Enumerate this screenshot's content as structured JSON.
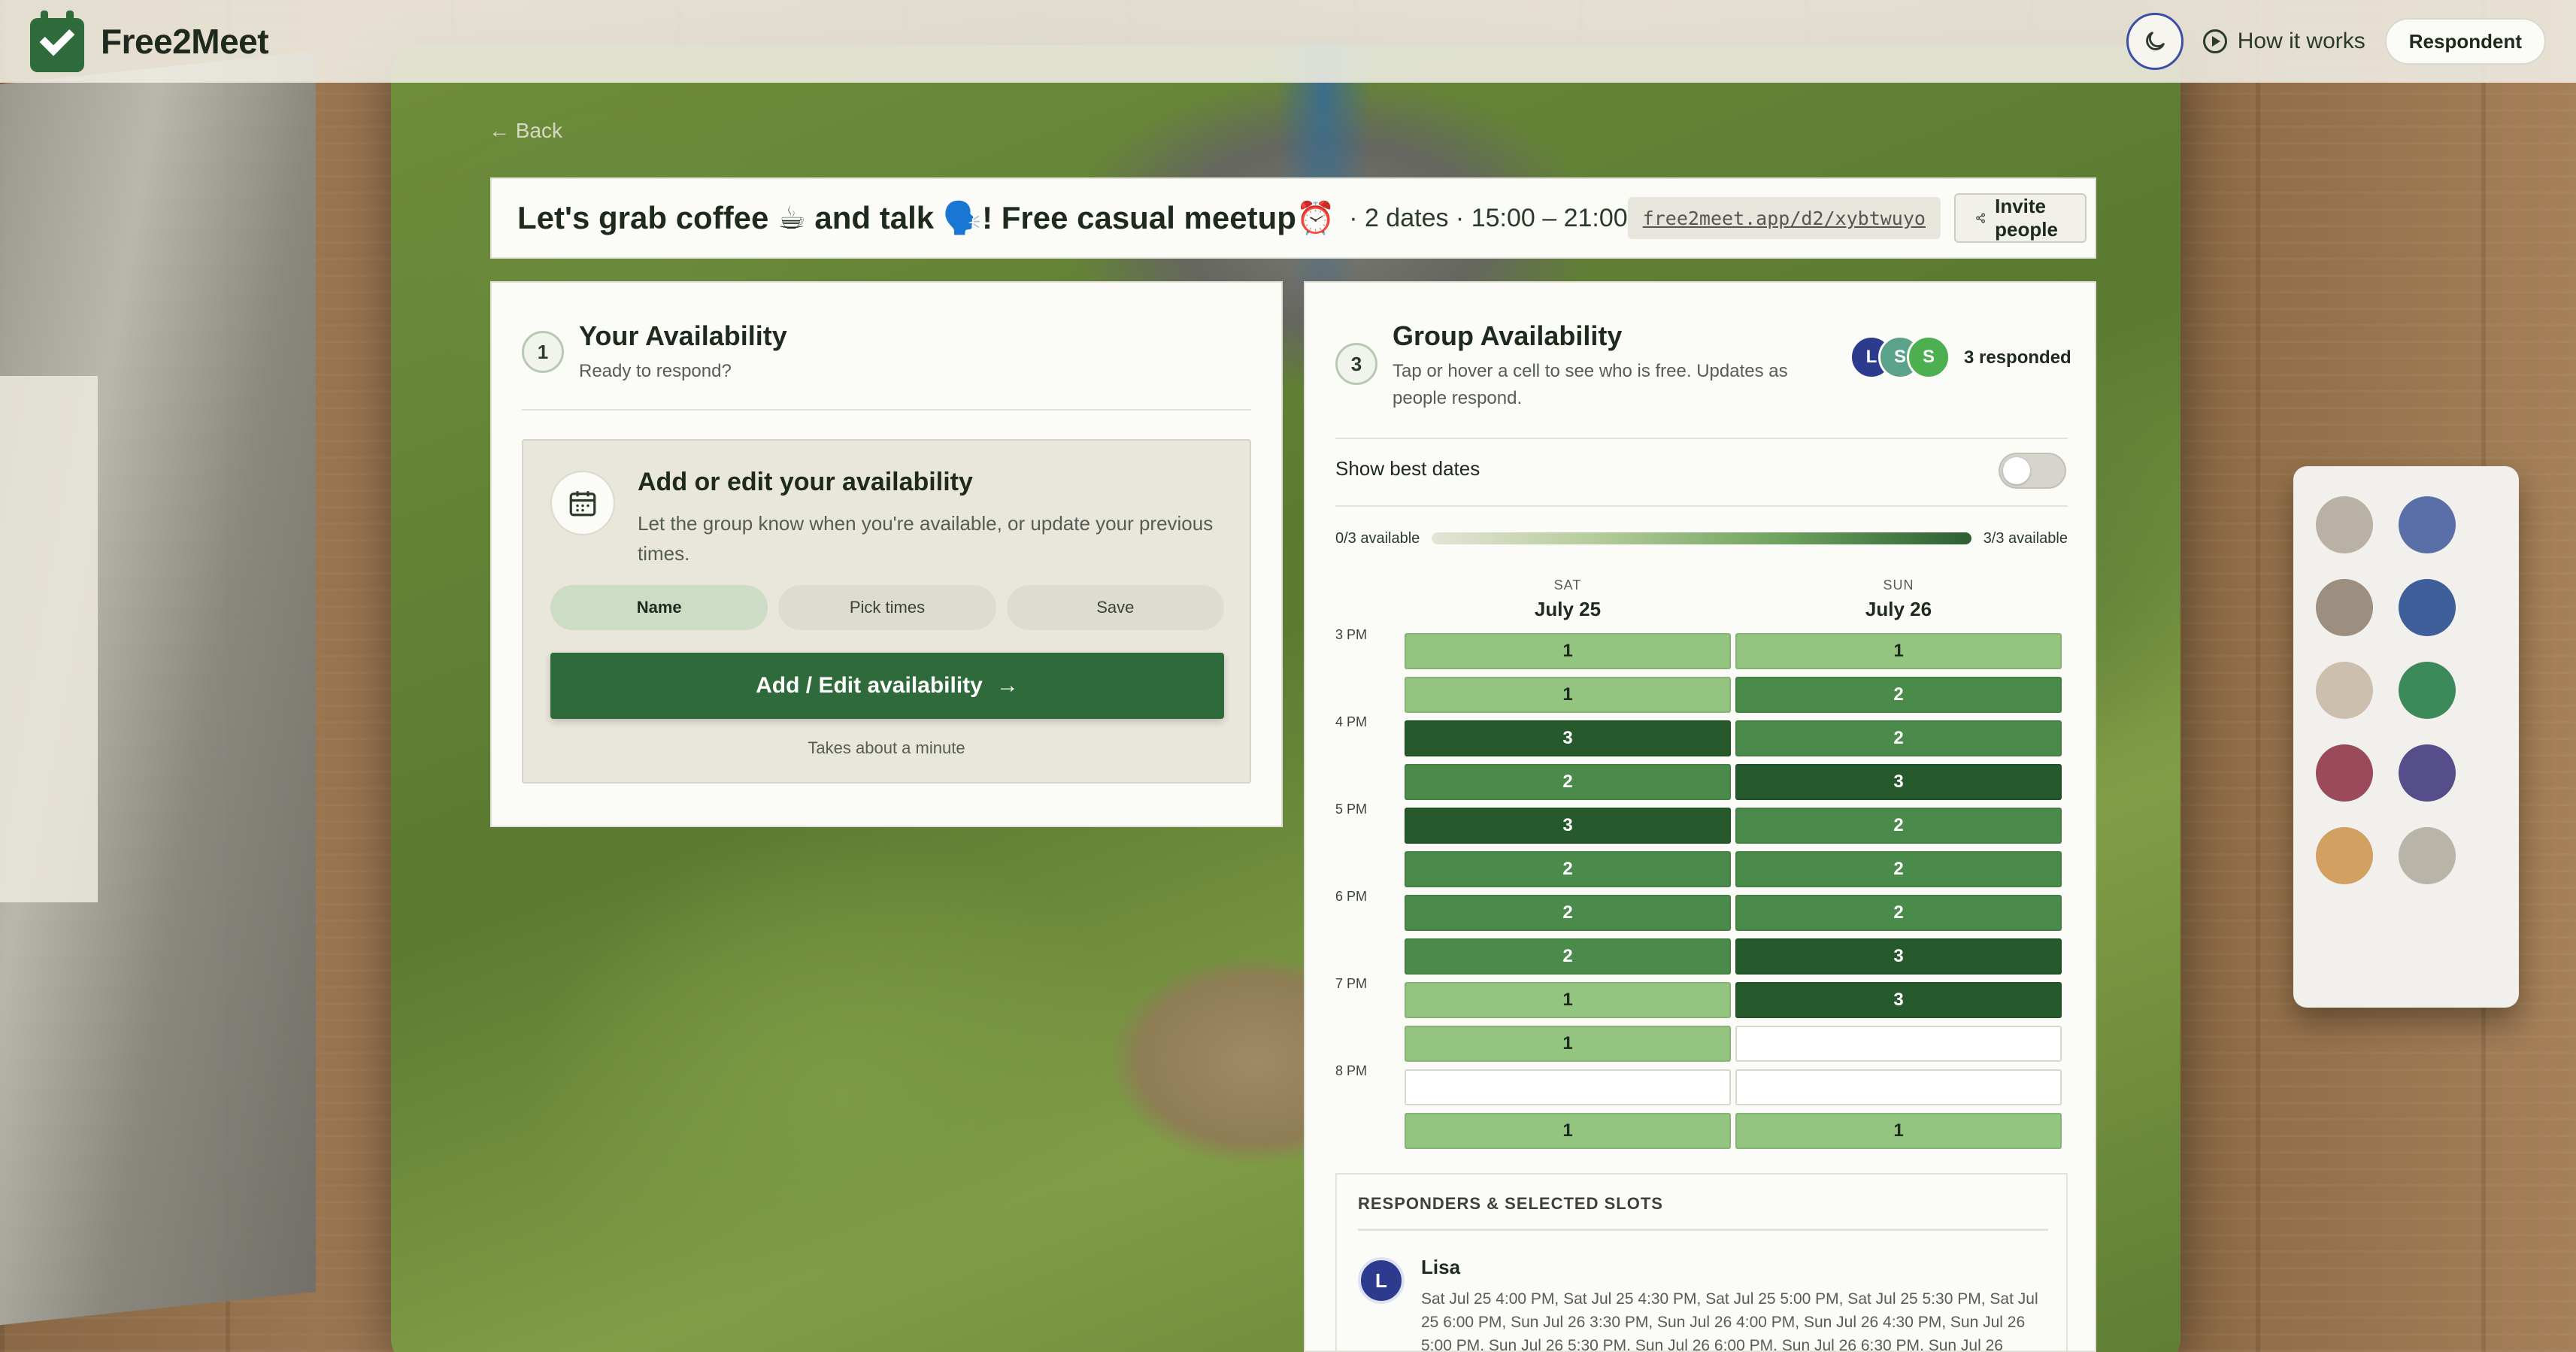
{
  "app": {
    "name": "Free2Meet"
  },
  "header": {
    "theme_toggle_icon": "moon-icon",
    "how_it_works": "How it works",
    "respondent": "Respondent"
  },
  "back": "← Back",
  "event": {
    "title": "Let's grab coffee ☕ and talk 🗣️! Free casual meetup⏰",
    "meta": "· 2 dates · 15:00 – 21:00",
    "link": "free2meet.app/d2/xybtwuyo",
    "invite_label": "Invite people"
  },
  "your_availability": {
    "step": "1",
    "title": "Your Availability",
    "subtitle": "Ready to respond?",
    "card_title": "Add or edit your availability",
    "card_text": "Let the group know when you're available, or update your previous times.",
    "steps": [
      "Name",
      "Pick times",
      "Save"
    ],
    "active_step": "Name",
    "button_label": "Add / Edit availability",
    "button_arrow": "→",
    "hint": "Takes about a minute"
  },
  "group_availability": {
    "step": "3",
    "title": "Group Availability",
    "subtitle": "Tap or hover a cell to see who is free. Updates as people respond.",
    "avatars": [
      {
        "initial": "L",
        "color": "#2d3b8f"
      },
      {
        "initial": "S",
        "color": "#5aa28a"
      },
      {
        "initial": "S",
        "color": "#4caf50"
      }
    ],
    "responded": "3 responded",
    "show_best_dates": "Show best dates",
    "show_best_dates_on": false,
    "legend_min": "0/3 available",
    "legend_max": "3/3 available",
    "total_people": 3,
    "days": [
      {
        "dow": "SAT",
        "date": "July 25"
      },
      {
        "dow": "SUN",
        "date": "July 26"
      }
    ],
    "time_labels": [
      "3 PM",
      "",
      "4 PM",
      "",
      "5 PM",
      "",
      "6 PM",
      "",
      "7 PM",
      "",
      "8 PM",
      ""
    ],
    "grid": [
      [
        1,
        1,
        3,
        2,
        3,
        2,
        2,
        2,
        1,
        1,
        0,
        1
      ],
      [
        1,
        2,
        2,
        3,
        2,
        2,
        2,
        3,
        3,
        0,
        0,
        1
      ]
    ],
    "colors": {
      "level1": "#93c480",
      "level2": "#4a8a4b",
      "level3": "#265a2d",
      "empty": "#ffffff"
    }
  },
  "responders": {
    "header": "RESPONDERS & SELECTED SLOTS",
    "list": [
      {
        "initial": "L",
        "name": "Lisa",
        "slots": "Sat Jul 25 4:00 PM, Sat Jul 25 4:30 PM, Sat Jul 25 5:00 PM, Sat Jul 25 5:30 PM, Sat Jul 25 6:00 PM, Sun Jul 26 3:30 PM, Sun Jul 26 4:00 PM, Sun Jul 26 4:30 PM, Sun Jul 26 5:00 PM, Sun Jul 26 5:30 PM, Sun Jul 26 6:00 PM, Sun Jul 26 6:30 PM, Sun Jul 26"
      }
    ]
  }
}
